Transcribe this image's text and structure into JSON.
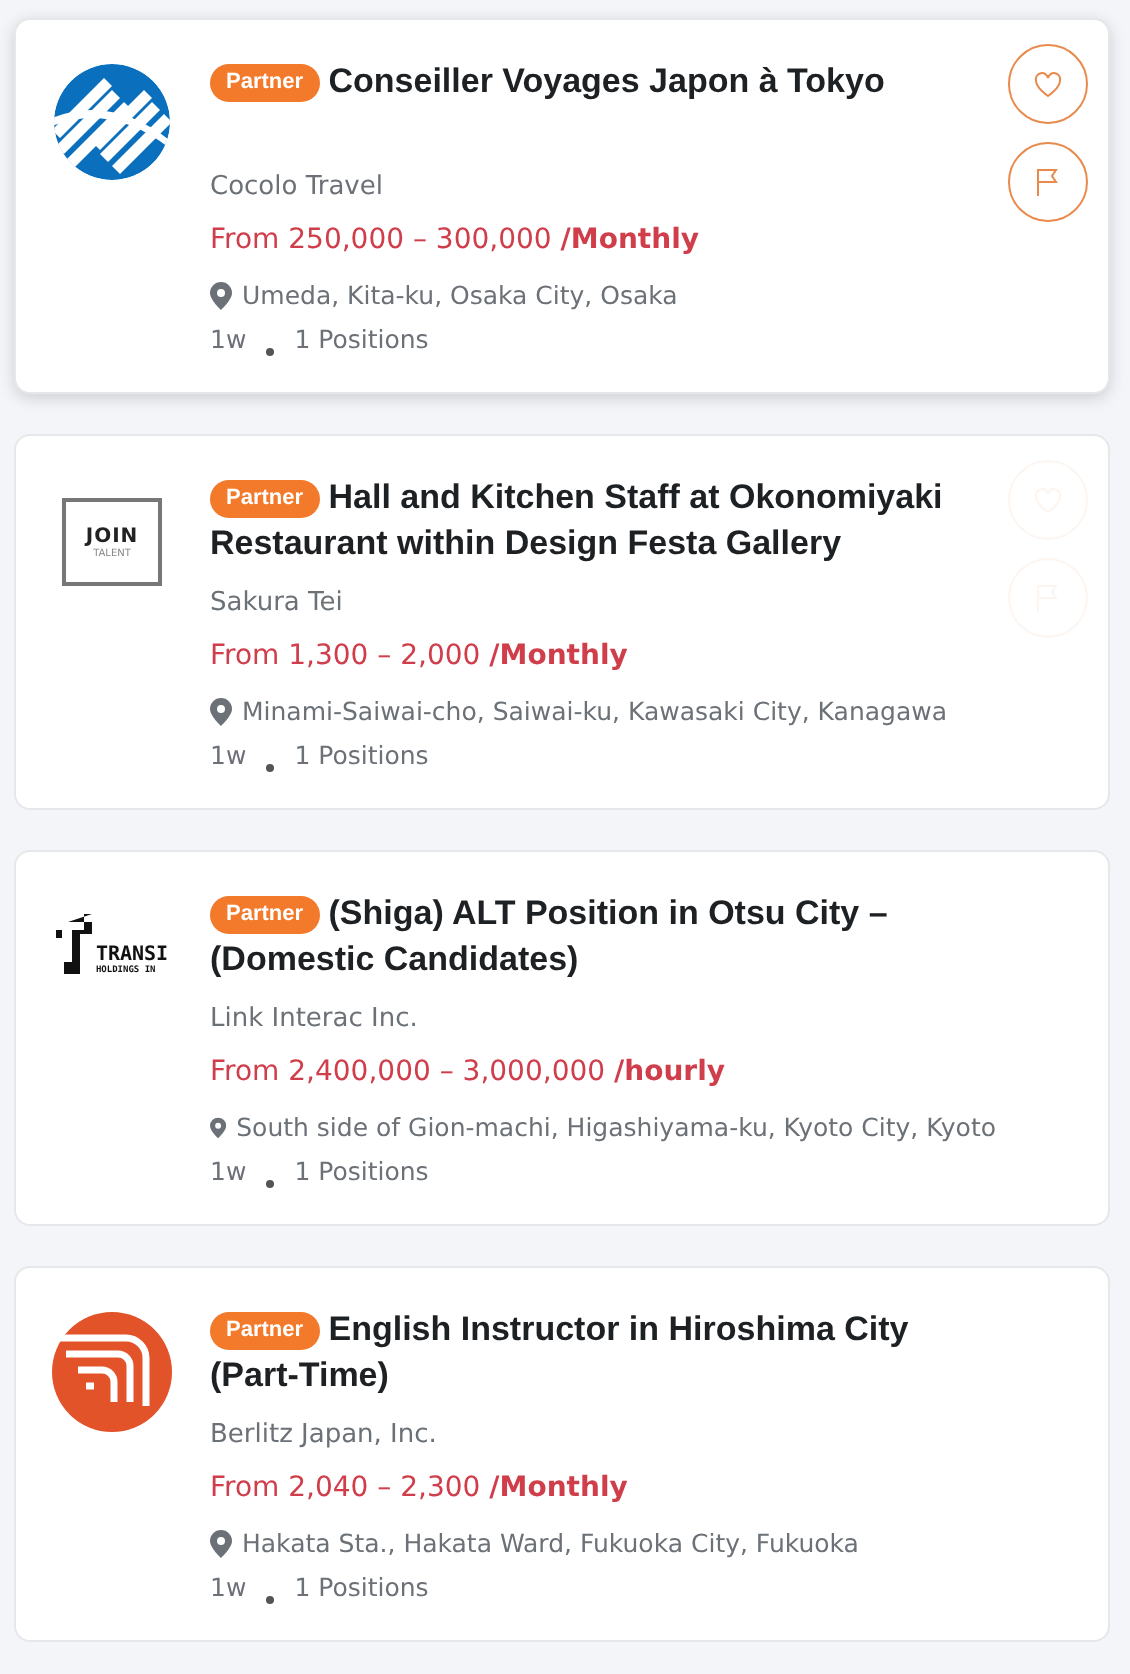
{
  "jobs": [
    {
      "logo": {
        "kind": "stripes-circle"
      },
      "badge": "Partner",
      "title": "Conseiller Voyages Japon à Tokyo",
      "company": "Cocolo Travel",
      "salary": "From 250,000 – 300,000 **/Monthly**",
      "location": "Umeda, Kita-ku, Osaka City, Osaka",
      "age": "1w",
      "positions": "1 Positions",
      "hovered": true,
      "actions_faded": false
    },
    {
      "logo": {
        "kind": "frame",
        "text": "JOIN",
        "subtext": "TALENT"
      },
      "badge": "Partner",
      "title": "Hall and Kitchen Staff at Okonomiyaki Restaurant within Design Festa Gallery",
      "company": "Sakura Tei",
      "salary": "From 1,300 – 2,000 **/Monthly**",
      "location": "Minami-Saiwai-cho, Saiwai-ku, Kawasaki City, Kanagawa",
      "age": "1w",
      "positions": "1 Positions",
      "hovered": false,
      "actions_faded": true
    },
    {
      "logo": {
        "kind": "bracket",
        "text": "TRANSI",
        "subtext": "HOLDINGS IN"
      },
      "badge": "Partner",
      "title": "(Shiga) ALT Position in Otsu City – (Domestic Candidates)",
      "company": "Link Interac Inc.",
      "salary": "From 2,400,000 – 3,000,000 **/hourly**",
      "location": "South side of Gion-machi, Higashiyama-ku, Kyoto City, Kyoto",
      "age": "1w",
      "positions": "1 Positions",
      "hovered": false
    },
    {
      "logo": {
        "kind": "squares-circle"
      },
      "badge": "Partner",
      "title": "English Instructor in Hiroshima City (Part-Time)",
      "company": "Berlitz Japan, Inc.",
      "salary": "From 2,040 – 2,300 **/Monthly**",
      "location": "Hakata Sta., Hakata Ward, Fukuoka City, Fukuoka",
      "age": "1w",
      "positions": "1 Positions",
      "hovered": false
    }
  ]
}
